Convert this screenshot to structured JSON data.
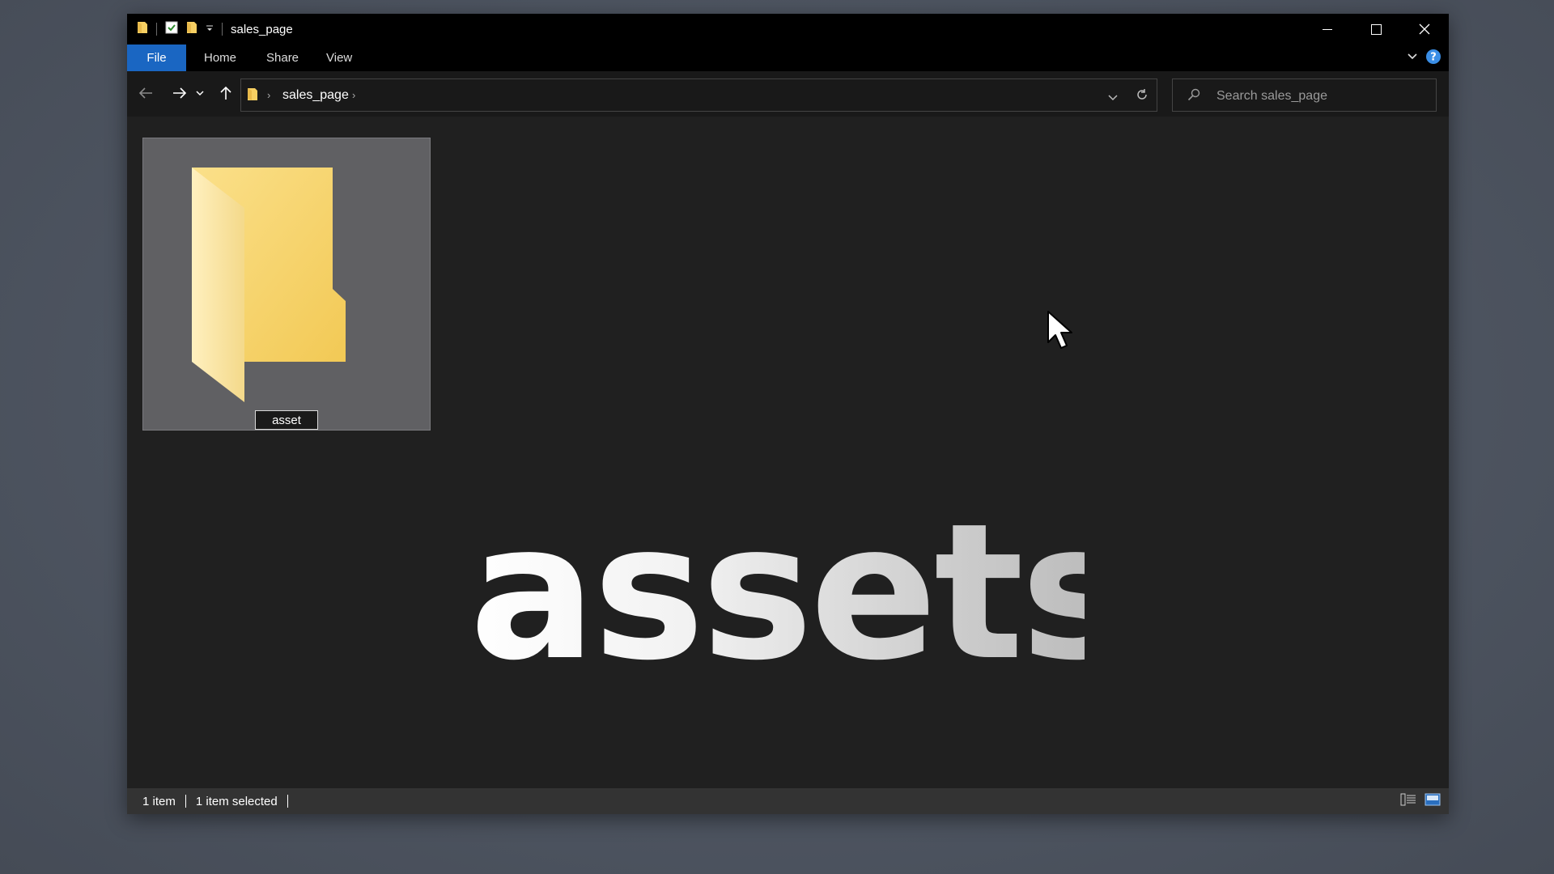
{
  "window": {
    "title": "sales_page"
  },
  "ribbon": {
    "tabs": [
      "File",
      "Home",
      "Share",
      "View"
    ]
  },
  "address": {
    "breadcrumb": "sales_page"
  },
  "search": {
    "placeholder": "Search sales_page"
  },
  "items": [
    {
      "rename_value": "asset"
    }
  ],
  "overlay_text": "assets",
  "status": {
    "item_count": "1 item",
    "selected": "1 item selected"
  },
  "colors": {
    "accent": "#1a66c2",
    "folder": "#f6cf62",
    "help": "#3a8ee6"
  }
}
